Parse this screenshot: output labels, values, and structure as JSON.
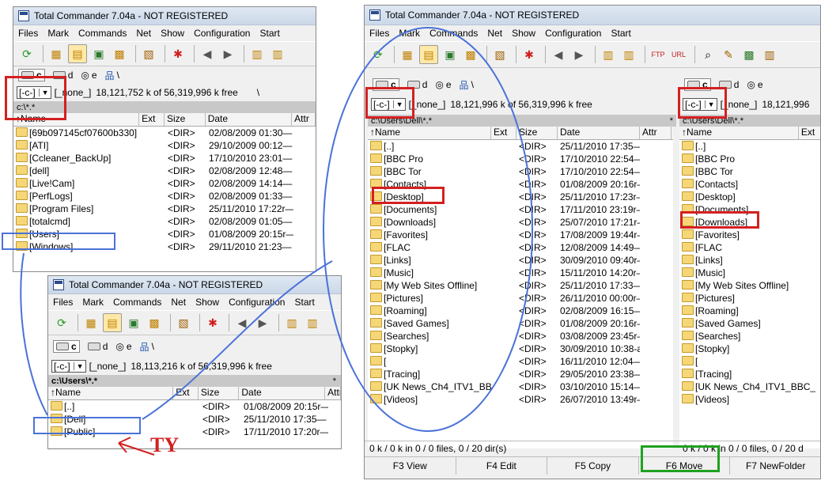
{
  "app_title": "Total Commander 7.04a - NOT REGISTERED",
  "menu": [
    "Files",
    "Mark",
    "Commands",
    "Net",
    "Show",
    "Configuration",
    "Start"
  ],
  "drives": [
    "c",
    "d",
    "e",
    "\\"
  ],
  "drive_combo": "[-c-]",
  "volume_label": "[_none_]",
  "columns": {
    "name": "↑Name",
    "ext": "Ext",
    "size": "Size",
    "date": "Date",
    "attr": "Attr"
  },
  "shot_a": {
    "free_text": "18,121,752 k of 56,319,996 k free",
    "path": "c:\\*.*",
    "path_right": "\\",
    "rows": [
      {
        "name": "[69b097145cf07600b330]",
        "size": "<DIR>",
        "date": "02/08/2009 01:30—"
      },
      {
        "name": "[ATI]",
        "size": "<DIR>",
        "date": "29/10/2009 00:12—"
      },
      {
        "name": "[Ccleaner_BackUp]",
        "size": "<DIR>",
        "date": "17/10/2010 23:01—"
      },
      {
        "name": "[dell]",
        "size": "<DIR>",
        "date": "02/08/2009 12:48—"
      },
      {
        "name": "[Live!Cam]",
        "size": "<DIR>",
        "date": "02/08/2009 14:14—"
      },
      {
        "name": "[PerfLogs]",
        "size": "<DIR>",
        "date": "02/08/2009 01:33—"
      },
      {
        "name": "[Program Files]",
        "size": "<DIR>",
        "date": "25/11/2010 17:22r—"
      },
      {
        "name": "[totalcmd]",
        "size": "<DIR>",
        "date": "02/08/2009 01:05—"
      },
      {
        "name": "[Users]",
        "size": "<DIR>",
        "date": "01/08/2009 20:15r—"
      },
      {
        "name": "[Windows]",
        "size": "<DIR>",
        "date": "29/11/2010 21:23—"
      }
    ]
  },
  "shot_b": {
    "free_text": "18,113,216 k of 56,319,996 k free",
    "path": "c:\\Users\\*.*",
    "path_right": "*",
    "rows": [
      {
        "name": "[..]",
        "size": "<DIR>",
        "date": "01/08/2009 20:15r—"
      },
      {
        "name": "[Dell]",
        "size": "<DIR>",
        "date": "25/11/2010 17:35—"
      },
      {
        "name": "[Public]",
        "size": "<DIR>",
        "date": "17/11/2010 17:20r—"
      }
    ],
    "annotation": "TY"
  },
  "shot_c": {
    "left": {
      "free_text": "18,121,996 k of 56,319,996 k free",
      "path": "c:\\Users\\Dell\\*.*",
      "path_right": "*",
      "rows": [
        {
          "name": "[..]",
          "size": "<DIR>",
          "date": "25/11/2010 17:35—"
        },
        {
          "name": "[BBC Pro",
          "size": "<DIR>",
          "date": "17/10/2010 22:54—"
        },
        {
          "name": "[BBC Tor",
          "size": "<DIR>",
          "date": "17/10/2010 22:54—"
        },
        {
          "name": "[Contacts]",
          "size": "<DIR>",
          "date": "01/08/2009 20:16r—"
        },
        {
          "name": "[Desktop]",
          "size": "<DIR>",
          "date": "25/11/2010 17:23r—"
        },
        {
          "name": "[Documents]",
          "size": "<DIR>",
          "date": "17/11/2010 23:19r—"
        },
        {
          "name": "[Downloads]",
          "size": "<DIR>",
          "date": "25/07/2010 17:21r—"
        },
        {
          "name": "[Favorites]",
          "size": "<DIR>",
          "date": "17/08/2009 19:44r—"
        },
        {
          "name": "[FLAC",
          "size": "<DIR>",
          "date": "12/08/2009 14:49—"
        },
        {
          "name": "[Links]",
          "size": "<DIR>",
          "date": "30/09/2010 09:40r—"
        },
        {
          "name": "[Music]",
          "size": "<DIR>",
          "date": "15/11/2010 14:20r—"
        },
        {
          "name": "[My Web Sites Offline]",
          "size": "<DIR>",
          "date": "25/11/2010 17:33—"
        },
        {
          "name": "[Pictures]",
          "size": "<DIR>",
          "date": "26/11/2010 00:00r—"
        },
        {
          "name": "[Roaming]",
          "size": "<DIR>",
          "date": "02/08/2009 16:15—"
        },
        {
          "name": "[Saved Games]",
          "size": "<DIR>",
          "date": "01/08/2009 20:16r—"
        },
        {
          "name": "[Searches]",
          "size": "<DIR>",
          "date": "03/08/2009 23:45r—"
        },
        {
          "name": "[Stopky]",
          "size": "<DIR>",
          "date": "30/09/2010 10:38-a—"
        },
        {
          "name": "[",
          "size": "<DIR>",
          "date": "16/11/2010 12:04—"
        },
        {
          "name": "[Tracing]",
          "size": "<DIR>",
          "date": "29/05/2010 23:38—"
        },
        {
          "name": "[UK News_Ch4_ITV1_BBC_...]",
          "size": "<DIR>",
          "date": "03/10/2010 15:14—"
        },
        {
          "name": "[Videos]",
          "size": "<DIR>",
          "date": "26/07/2010 13:49r—"
        }
      ],
      "status": "0 k / 0 k in 0 / 0 files, 0 / 20 dir(s)"
    },
    "right": {
      "free_text": "18,121,996",
      "path": "c:\\Users\\Dell\\*.*",
      "rows": [
        "[..]",
        "[BBC Pro",
        "[BBC Tor",
        "[Contacts]",
        "[Desktop]",
        "[Documents]",
        "[Downloads]",
        "[Favorites]",
        "[FLAC",
        "[Links]",
        "[Music]",
        "[My Web Sites Offline]",
        "[Pictures]",
        "[Roaming]",
        "[Saved Games]",
        "[Searches]",
        "[Stopky]",
        "[",
        "[Tracing]",
        "[UK News_Ch4_ITV1_BBC_",
        "[Videos]"
      ],
      "status": "0 k / 0 k in 0 / 0 files, 0 / 20 d"
    },
    "fkeys": [
      "F3 View",
      "F4 Edit",
      "F5 Copy",
      "F6 Move",
      "F7 NewFolder"
    ]
  },
  "colors": {
    "annotation_red": "#d42020",
    "annotation_blue": "#4a72d8",
    "annotation_green": "#20a020",
    "folder": "#f5d778"
  }
}
